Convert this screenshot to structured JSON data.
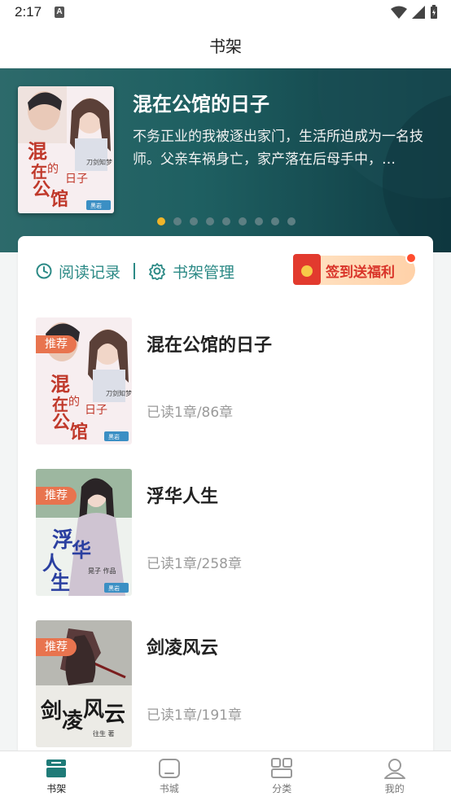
{
  "status_bar": {
    "time": "2:17",
    "notif_letter": "A"
  },
  "header": {
    "title": "书架"
  },
  "banner": {
    "title": "混在公馆的日子",
    "description": "不务正业的我被逐出家门，生活所迫成为一名技师。父亲车祸身亡，家产落在后母手中，…",
    "dot_count": 9,
    "active_dot": 0,
    "cover": {
      "title_art": "混在公馆的日子",
      "author": "刀剑知梦",
      "logo": "黑岩"
    }
  },
  "shelf": {
    "reading_history": "阅读记录",
    "shelf_manage": "书架管理",
    "signin": "签到送福利",
    "books": [
      {
        "title": "混在公馆的日子",
        "badge": "推荐",
        "progress": "已读1章/86章",
        "cover_text": "混在公馆的日子",
        "cover_author": "刀剑知梦",
        "cover_logo": "黑岩"
      },
      {
        "title": "浮华人生",
        "badge": "推荐",
        "progress": "已读1章/258章",
        "cover_text": "浮华人生",
        "cover_author": "晃子 作品",
        "cover_logo": "黑岩"
      },
      {
        "title": "剑凌风云",
        "badge": "推荐",
        "progress": "已读1章/191章",
        "cover_text": "剑凌风云",
        "cover_author": "往生 著",
        "cover_logo": ""
      }
    ]
  },
  "nav": [
    {
      "label": "书架",
      "icon": "bookshelf-icon",
      "active": true
    },
    {
      "label": "书城",
      "icon": "bookstore-icon",
      "active": false
    },
    {
      "label": "分类",
      "icon": "category-grid-icon",
      "active": false
    },
    {
      "label": "我的",
      "icon": "profile-icon",
      "active": false
    }
  ],
  "colors": {
    "accent": "#2c8a86",
    "banner_dark": "#0f3a42",
    "dot_active": "#f0b429",
    "badge": "#e8744f",
    "signin_red": "#d9352a"
  }
}
